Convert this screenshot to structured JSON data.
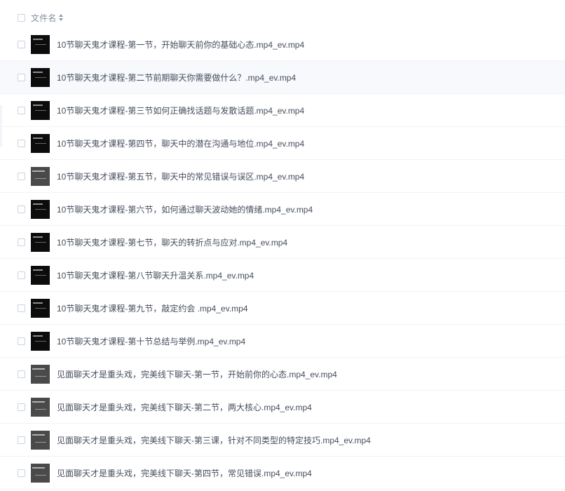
{
  "header": {
    "label": "文件名"
  },
  "files": [
    {
      "name": "10节聊天鬼才课程-第一节，开始聊天前你的基础心态.mp4_ev.mp4",
      "thumb": "dark"
    },
    {
      "name": "10节聊天鬼才课程-第二节前期聊天你需要做什么？.mp4_ev.mp4",
      "thumb": "dark"
    },
    {
      "name": "10节聊天鬼才课程-第三节如何正确找话题与发散话题.mp4_ev.mp4",
      "thumb": "dark"
    },
    {
      "name": "10节聊天鬼才课程-第四节，聊天中的潜在沟通与地位.mp4_ev.mp4",
      "thumb": "dark"
    },
    {
      "name": "10节聊天鬼才课程-第五节，聊天中的常见错误与误区.mp4_ev.mp4",
      "thumb": "gray"
    },
    {
      "name": "10节聊天鬼才课程-第六节，如何通过聊天波动她的情绪.mp4_ev.mp4",
      "thumb": "dark"
    },
    {
      "name": "10节聊天鬼才课程-第七节，聊天的转折点与应对.mp4_ev.mp4",
      "thumb": "dark"
    },
    {
      "name": "10节聊天鬼才课程-第八节聊天升温关系.mp4_ev.mp4",
      "thumb": "dark"
    },
    {
      "name": "10节聊天鬼才课程-第九节，敲定约会 .mp4_ev.mp4",
      "thumb": "dark"
    },
    {
      "name": "10节聊天鬼才课程-第十节总结与举例.mp4_ev.mp4",
      "thumb": "dark"
    },
    {
      "name": "见面聊天才是重头戏，完美线下聊天-第一节，开始前你的心态.mp4_ev.mp4",
      "thumb": "gray"
    },
    {
      "name": "见面聊天才是重头戏，完美线下聊天-第二节，两大核心.mp4_ev.mp4",
      "thumb": "gray"
    },
    {
      "name": "见面聊天才是重头戏，完美线下聊天-第三课，针对不同类型的特定技巧.mp4_ev.mp4",
      "thumb": "gray"
    },
    {
      "name": "见面聊天才是重头戏，完美线下聊天-第四节，常见错误.mp4_ev.mp4",
      "thumb": "gray"
    }
  ],
  "highlighted_index": 1,
  "colors": {
    "text": "#454d5c",
    "header_text": "#818ea3",
    "row_hover": "#f7f9fc",
    "checkbox_border": "#c9d3e3"
  }
}
